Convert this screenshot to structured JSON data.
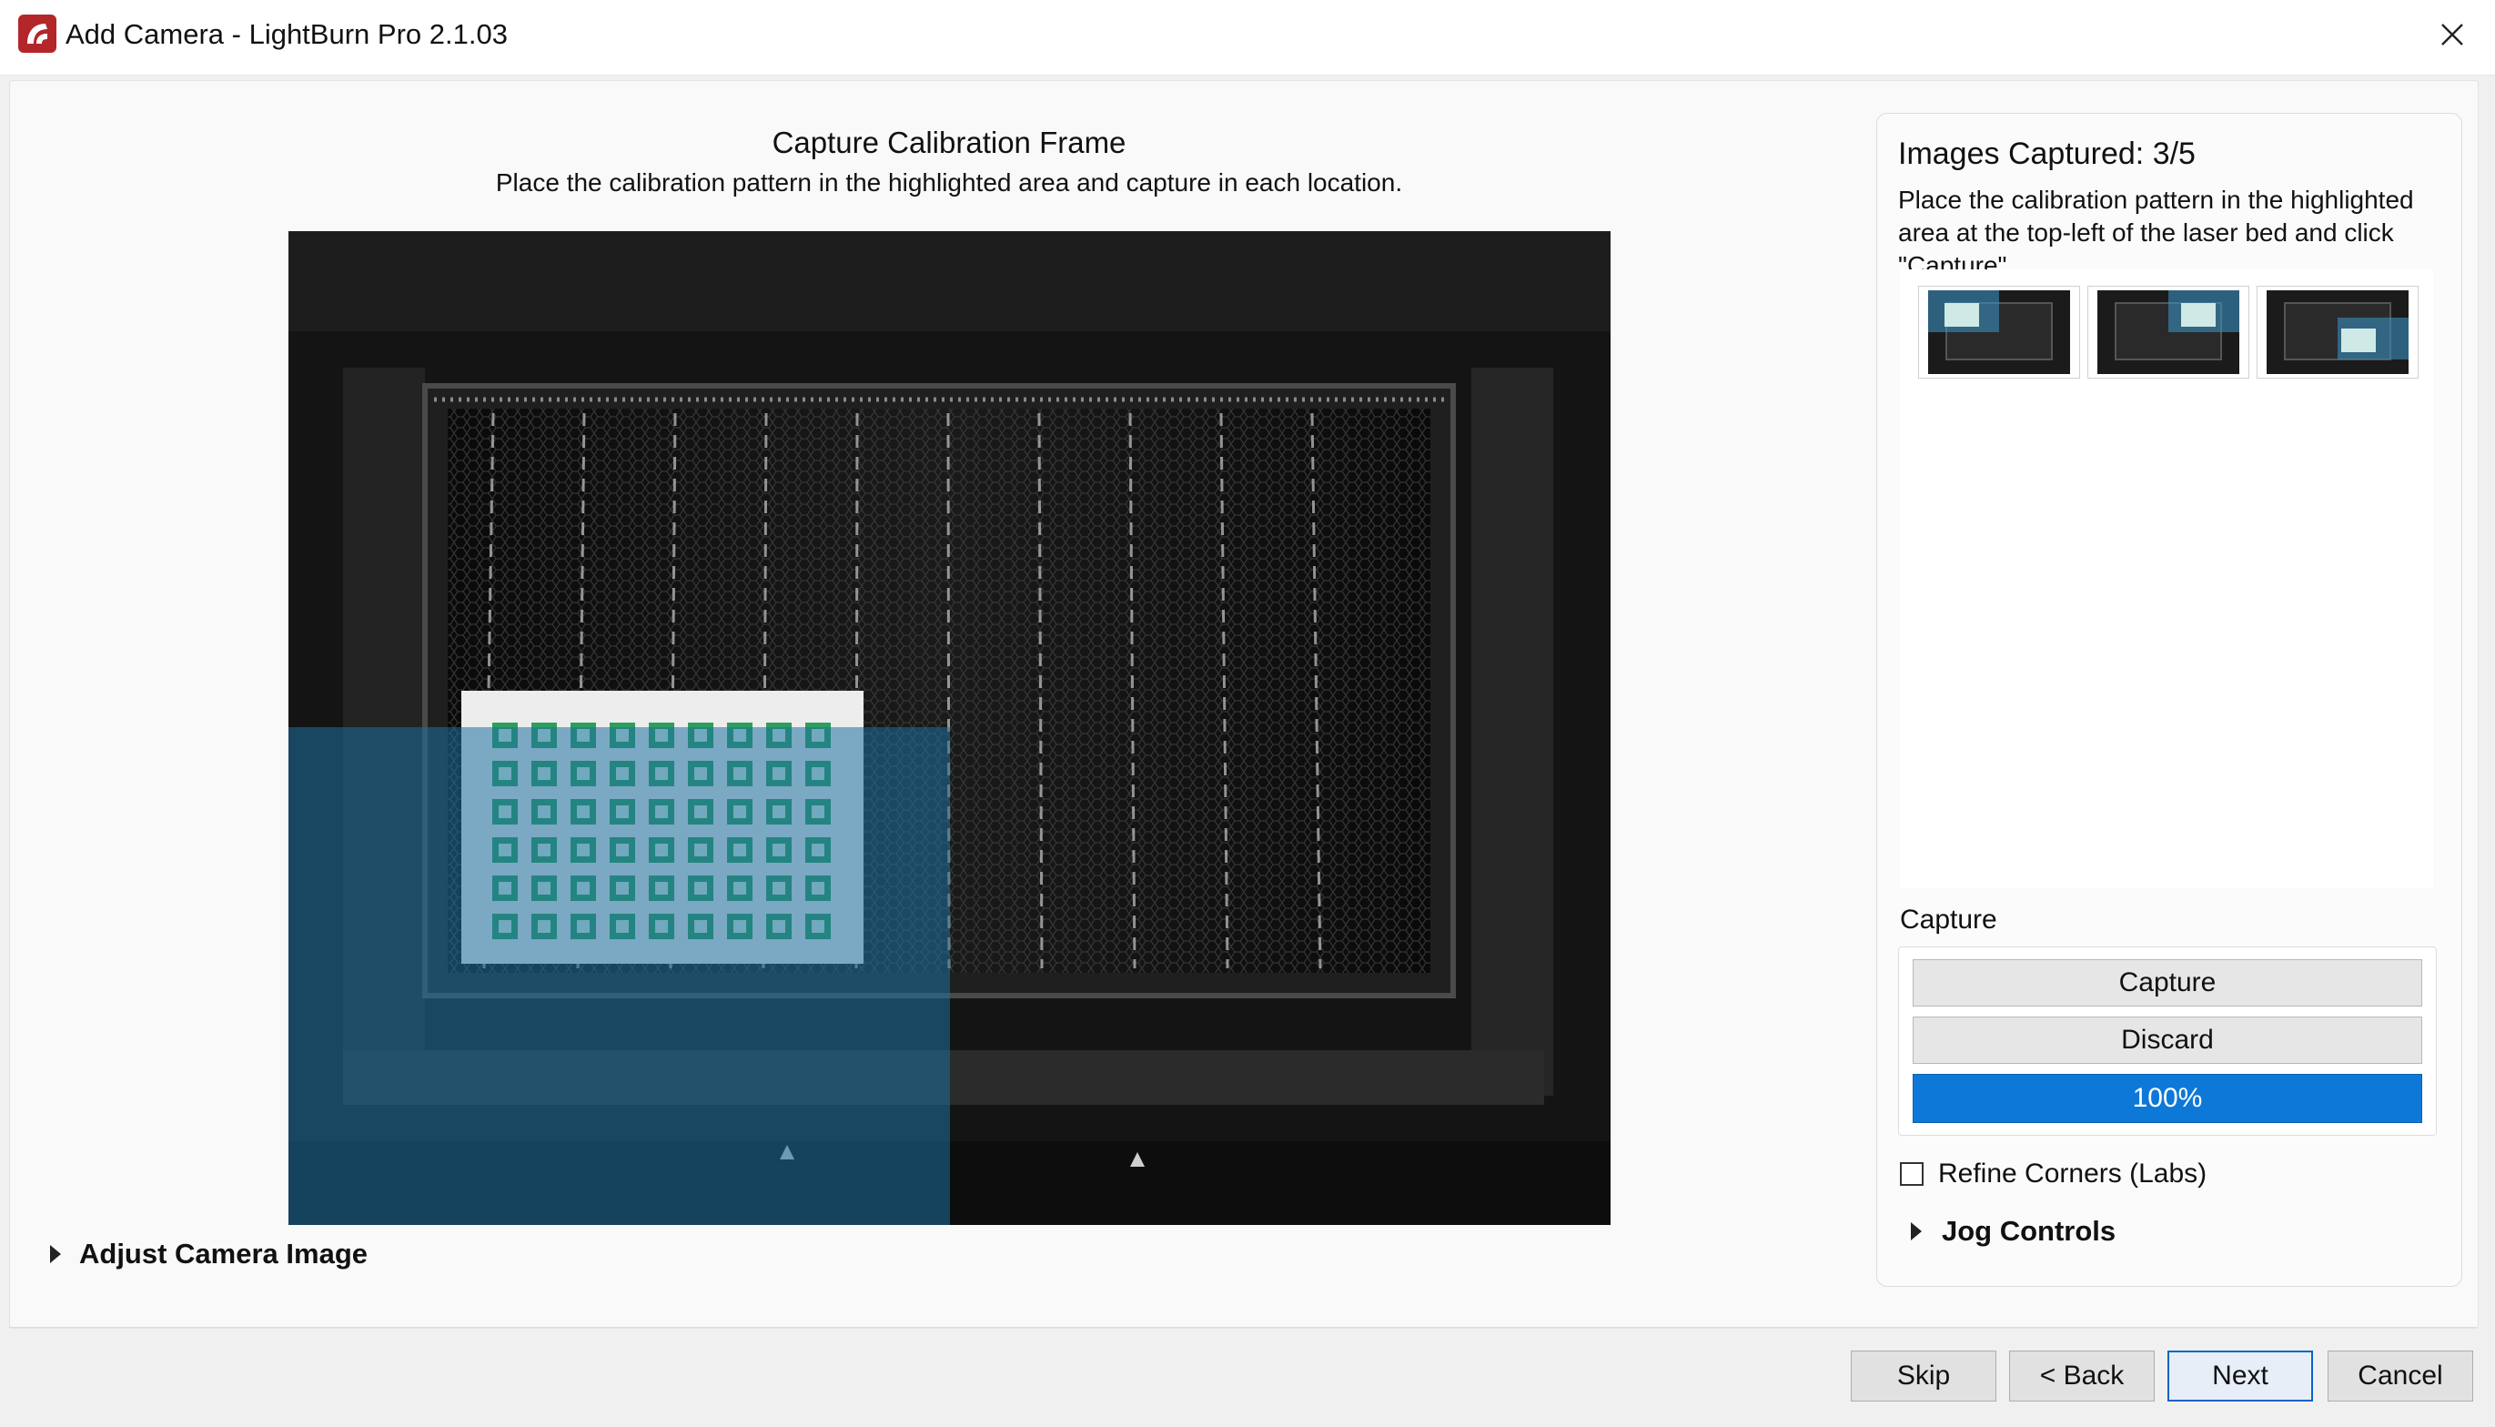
{
  "window": {
    "title": "Add Camera - LightBurn Pro 2.1.03"
  },
  "main": {
    "step_title": "Capture Calibration Frame",
    "step_subtitle": "Place the calibration pattern in the highlighted area and capture in each location.",
    "adjust_camera_label": "Adjust Camera Image"
  },
  "panel": {
    "images_captured": "Images Captured: 3/5",
    "instructions": "Place the calibration pattern in the highlighted area at the top-left of the laser bed and click \"Capture\".",
    "thumbnails": [
      {
        "position": "top-left"
      },
      {
        "position": "top-right"
      },
      {
        "position": "center-right"
      }
    ],
    "capture_section_label": "Capture",
    "capture_button": "Capture",
    "discard_button": "Discard",
    "progress": {
      "value": 1.0,
      "label": "100%"
    },
    "refine_corners_label": "Refine Corners (Labs)",
    "refine_corners_checked": false,
    "jog_controls_label": "Jog Controls"
  },
  "footer": {
    "skip": "Skip",
    "back": "< Back",
    "next": "Next",
    "cancel": "Cancel"
  },
  "colors": {
    "accent": "#0e78d8",
    "highlight_overlay": "#1e6fa0",
    "calibration_marker": "#2e9e5e"
  },
  "icons": {
    "app": "lightburn-logo-icon",
    "close": "close-icon",
    "expand": "caret-right-icon"
  }
}
